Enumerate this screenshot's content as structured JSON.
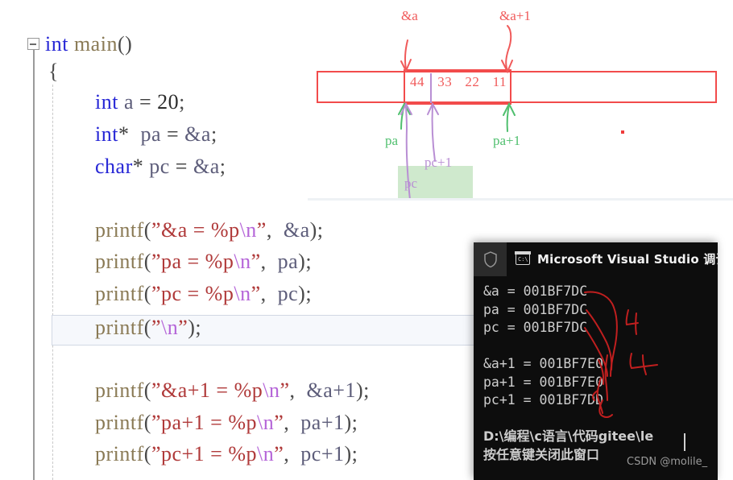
{
  "editor": {
    "fold_marker": "−",
    "lines": [
      {
        "indent": 0,
        "tokens": [
          {
            "t": "int",
            "c": "kw"
          },
          {
            "t": " ",
            "c": "op"
          },
          {
            "t": "main",
            "c": "fn"
          },
          {
            "t": "()",
            "c": "punct"
          }
        ]
      },
      {
        "indent": 1,
        "tokens": [
          {
            "t": "{",
            "c": "punct"
          }
        ]
      },
      {
        "indent": 2,
        "tokens": [
          {
            "t": "int",
            "c": "kw"
          },
          {
            "t": " a ",
            "c": "var"
          },
          {
            "t": "= ",
            "c": "op"
          },
          {
            "t": "20",
            "c": "num"
          },
          {
            "t": ";",
            "c": "punct"
          }
        ]
      },
      {
        "indent": 2,
        "tokens": [
          {
            "t": "int",
            "c": "kw"
          },
          {
            "t": "*",
            "c": "op"
          },
          {
            "t": "  pa ",
            "c": "var"
          },
          {
            "t": "= ",
            "c": "op"
          },
          {
            "t": "&a",
            "c": "var"
          },
          {
            "t": ";",
            "c": "punct"
          }
        ]
      },
      {
        "indent": 2,
        "tokens": [
          {
            "t": "char",
            "c": "kw"
          },
          {
            "t": "*",
            "c": "op"
          },
          {
            "t": " pc ",
            "c": "var"
          },
          {
            "t": "= ",
            "c": "op"
          },
          {
            "t": "&a",
            "c": "var"
          },
          {
            "t": ";",
            "c": "punct"
          }
        ]
      },
      {
        "indent": 2,
        "tokens": [
          {
            "t": "printf",
            "c": "fn"
          },
          {
            "t": "(",
            "c": "punct"
          },
          {
            "t": "\"&a = %p",
            "c": "str"
          },
          {
            "t": "\\n",
            "c": "esc"
          },
          {
            "t": "\"",
            "c": "str"
          },
          {
            "t": ",  ",
            "c": "punct"
          },
          {
            "t": "&a",
            "c": "var"
          },
          {
            "t": ");",
            "c": "punct"
          }
        ]
      },
      {
        "indent": 2,
        "tokens": [
          {
            "t": "printf",
            "c": "fn"
          },
          {
            "t": "(",
            "c": "punct"
          },
          {
            "t": "\"pa = %p",
            "c": "str"
          },
          {
            "t": "\\n",
            "c": "esc"
          },
          {
            "t": "\"",
            "c": "str"
          },
          {
            "t": ",  ",
            "c": "punct"
          },
          {
            "t": "pa",
            "c": "var"
          },
          {
            "t": ");",
            "c": "punct"
          }
        ]
      },
      {
        "indent": 2,
        "tokens": [
          {
            "t": "printf",
            "c": "fn"
          },
          {
            "t": "(",
            "c": "punct"
          },
          {
            "t": "\"pc = %p",
            "c": "str"
          },
          {
            "t": "\\n",
            "c": "esc"
          },
          {
            "t": "\"",
            "c": "str"
          },
          {
            "t": ",  ",
            "c": "punct"
          },
          {
            "t": "pc",
            "c": "var"
          },
          {
            "t": ");",
            "c": "punct"
          }
        ]
      },
      {
        "indent": 2,
        "tokens": [
          {
            "t": "printf",
            "c": "fn"
          },
          {
            "t": "(",
            "c": "punct"
          },
          {
            "t": "\"",
            "c": "str"
          },
          {
            "t": "\\n",
            "c": "esc"
          },
          {
            "t": "\"",
            "c": "str"
          },
          {
            "t": ");",
            "c": "punct"
          }
        ]
      },
      {
        "indent": 2,
        "tokens": [
          {
            "t": "printf",
            "c": "fn"
          },
          {
            "t": "(",
            "c": "punct"
          },
          {
            "t": "\"&a+1 = %p",
            "c": "str"
          },
          {
            "t": "\\n",
            "c": "esc"
          },
          {
            "t": "\"",
            "c": "str"
          },
          {
            "t": ",  ",
            "c": "punct"
          },
          {
            "t": "&a+1",
            "c": "var"
          },
          {
            "t": ");",
            "c": "punct"
          }
        ]
      },
      {
        "indent": 2,
        "tokens": [
          {
            "t": "printf",
            "c": "fn"
          },
          {
            "t": "(",
            "c": "punct"
          },
          {
            "t": "\"pa+1 = %p",
            "c": "str"
          },
          {
            "t": "\\n",
            "c": "esc"
          },
          {
            "t": "\"",
            "c": "str"
          },
          {
            "t": ",  ",
            "c": "punct"
          },
          {
            "t": "pa+1",
            "c": "var"
          },
          {
            "t": ");",
            "c": "punct"
          }
        ]
      },
      {
        "indent": 2,
        "tokens": [
          {
            "t": "printf",
            "c": "fn"
          },
          {
            "t": "(",
            "c": "punct"
          },
          {
            "t": "\"pc+1 = %p",
            "c": "str"
          },
          {
            "t": "\\n",
            "c": "esc"
          },
          {
            "t": "\"",
            "c": "str"
          },
          {
            "t": ",  ",
            "c": "punct"
          },
          {
            "t": "pc+1",
            "c": "var"
          },
          {
            "t": ");",
            "c": "punct"
          }
        ]
      }
    ],
    "plain_lines": [
      "int main()",
      "{",
      "int a = 20;",
      "int*  pa = &a;",
      "char* pc = &a;",
      "printf(\"&a = %p\\n\",  &a);",
      "printf(\"pa = %p\\n\",  pa);",
      "printf(\"pc = %p\\n\",  pc);",
      "printf(\"\\n\");",
      "printf(\"&a+1 = %p\\n\",  &a+1);",
      "printf(\"pa+1 = %p\\n\",  pa+1);",
      "printf(\"pc+1 = %p\\n\",  pc+1);"
    ]
  },
  "diagram": {
    "memory_bytes": [
      "44",
      "33",
      "22",
      "11"
    ],
    "labels": {
      "addr_a": "&a",
      "addr_a_plus1": "&a+1",
      "pa": "pa",
      "pa_plus1": "pa+1",
      "pc": "pc",
      "pc_plus1": "pc+1"
    },
    "colors": {
      "box": "#f24b4b",
      "value": "#f05a5a",
      "pointer_int": "#4fbf6e",
      "pointer_char": "#b98fd4",
      "highlight": "#cfe9cd"
    }
  },
  "console": {
    "title": "Microsoft Visual Studio 调试控",
    "shield_icon": "shield-icon",
    "console_icon_text": "C:\\",
    "output_lines": [
      "&a = 001BF7DC",
      "pa = 001BF7DC",
      "pc = 001BF7DC",
      "",
      "&a+1 = 001BF7E0",
      "pa+1 = 001BF7E0",
      "pc+1 = 001BF7DD",
      "",
      "D:\\编程\\c语言\\代码gitee\\le",
      "按任意键关闭此窗口"
    ],
    "watermark": "CSDN @molile_"
  }
}
